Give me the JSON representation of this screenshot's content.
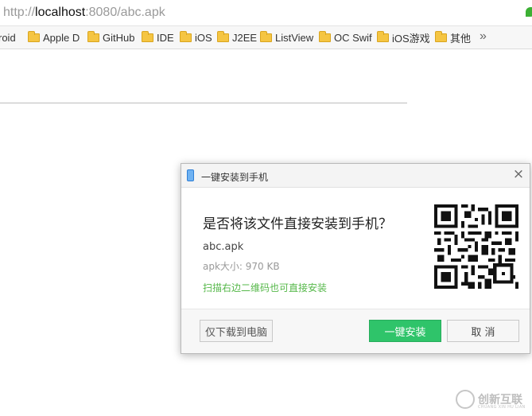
{
  "address_bar": {
    "scheme": "http://",
    "host": "localhost",
    "rest": ":8080/abc.apk"
  },
  "bookmarks": [
    {
      "label": "roid",
      "folder": false
    },
    {
      "label": "Apple D",
      "folder": true
    },
    {
      "label": "GitHub",
      "folder": true
    },
    {
      "label": "IDE",
      "folder": true
    },
    {
      "label": "iOS",
      "folder": true
    },
    {
      "label": "J2EE",
      "folder": true
    },
    {
      "label": "ListView",
      "folder": true
    },
    {
      "label": "OC Swif",
      "folder": true
    },
    {
      "label": "iOS游戏",
      "folder": true
    },
    {
      "label": "其他",
      "folder": true
    }
  ],
  "bookmarks_more": "»",
  "dialog": {
    "title": "一键安装到手机",
    "close": "×",
    "question": "是否将该文件直接安装到手机？",
    "filename": "abc.apk",
    "filesize": "apk大小: 970 KB",
    "scan_hint": "扫描右边二维码也可直接安装",
    "download_label": "仅下载到电脑",
    "install_label": "一键安装",
    "cancel_label": "取 消"
  },
  "watermark": {
    "text": "创新互联",
    "sub": "CHUANG XIN HU LIAN"
  },
  "colors": {
    "install_button": "#2fc46a",
    "hint_text": "#56b84a",
    "folder": "#f5c542"
  }
}
